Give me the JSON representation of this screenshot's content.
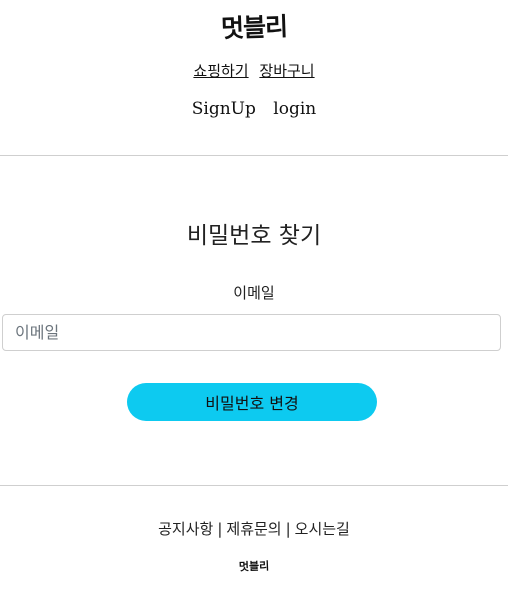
{
  "header": {
    "logo": "멋블리",
    "nav": {
      "shopping": "쇼핑하기",
      "cart": "장바구니"
    },
    "auth": {
      "signup": "SignUp",
      "login": "login"
    }
  },
  "main": {
    "title": "비밀번호 찾기",
    "email_label": "이메일",
    "email_value": "",
    "email_placeholder": "이메일",
    "submit_label": "비밀번호 변경"
  },
  "footer": {
    "links": [
      "공지사항",
      "제휴문의",
      "오시는길"
    ],
    "separator": "|",
    "logo": "멋블리"
  },
  "colors": {
    "accent": "#0dcaf0",
    "divider": "#cfcfcf",
    "text": "#222222"
  }
}
